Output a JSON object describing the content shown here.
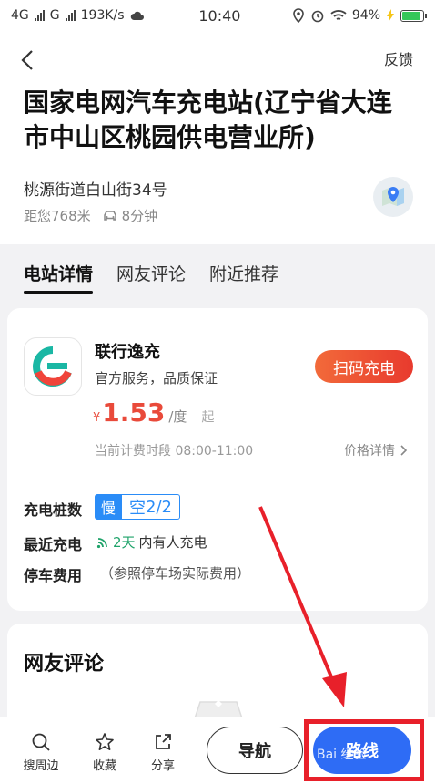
{
  "status_bar": {
    "left_net1": "4G",
    "left_net2": "G",
    "speed": "193K/s",
    "time": "10:40",
    "battery": "94%",
    "battery_level": 0.94
  },
  "header": {
    "feedback_label": "反馈",
    "title": "国家电网汽车充电站(辽宁省大连市中山区桃园供电营业所)",
    "address": "桃源街道白山街34号",
    "distance": "距您768米",
    "drive_time": "8分钟"
  },
  "tabs": [
    {
      "label": "电站详情"
    },
    {
      "label": "网友评论"
    },
    {
      "label": "附近推荐"
    }
  ],
  "operator": {
    "name": "联行逸充",
    "slogan": "官方服务，品质保证",
    "price_symbol": "¥",
    "price": "1.53",
    "price_unit": "/度",
    "price_from": "起",
    "period": "当前计费时段 08:00-11:00",
    "price_detail_label": "价格详情",
    "scan_label": "扫码充电"
  },
  "details": {
    "piles_label": "充电桩数",
    "slow_label": "慢",
    "free_prefix": "空",
    "free_count": "2",
    "total_count": "/2",
    "recent_label": "最近充电",
    "recent_days": "2天",
    "recent_suffix": "内有人充电",
    "parking_label": "停车费用",
    "parking_value": "（参照停车场实际费用）"
  },
  "reviews": {
    "title": "网友评论"
  },
  "bottom_bar": {
    "search_label": "搜周边",
    "favorite_label": "收藏",
    "share_label": "分享",
    "navigate_label": "导航",
    "route_label": "路线",
    "watermark": "Bai 经验"
  },
  "colors": {
    "accent_red": "#e94a3a",
    "route_blue": "#2e6cf5",
    "slow_blue": "#2a8cf7",
    "recent_green": "#1fa36a"
  }
}
